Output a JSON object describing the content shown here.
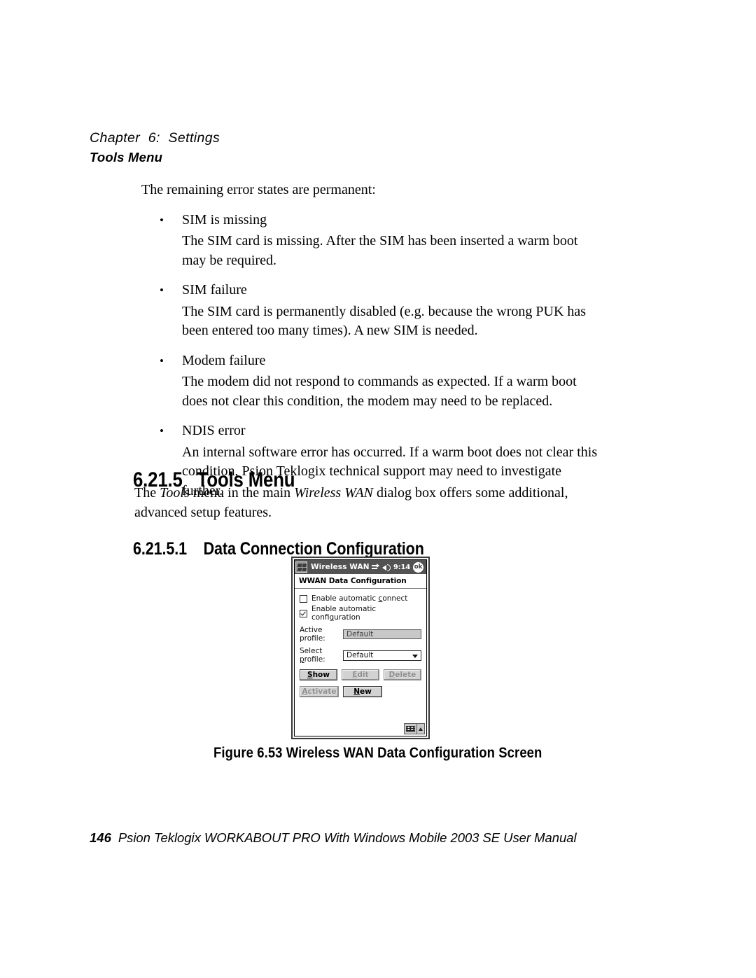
{
  "header": {
    "chapter": "Chapter  6:  Settings",
    "section": "Tools Menu"
  },
  "body": {
    "intro": "The remaining error states are permanent:",
    "bullets": [
      {
        "term": "SIM is missing",
        "desc": "The SIM card is missing. After the SIM has been inserted a warm boot may be required."
      },
      {
        "term": "SIM failure",
        "desc": "The SIM card is permanently disabled (e.g. because the wrong PUK has been entered too many times). A new SIM is needed."
      },
      {
        "term": "Modem failure",
        "desc": "The modem did not respond to commands as expected. If a warm boot does not clear this condition, the modem may need to be replaced."
      },
      {
        "term": "NDIS error",
        "desc": "An internal software error has occurred. If a warm boot does not clear this condition, Psion Teklogix technical support may need to investigate further."
      }
    ],
    "bullet_marker": "•"
  },
  "headings": {
    "h2_number": "6.21.5",
    "h2_title": "Tools Menu",
    "h2_full": "6.21.5   Tools Menu",
    "h3_number": "6.21.5.1",
    "h3_title": "Data Connection Configuration",
    "h3_full": "6.21.5.1    Data Connection Configuration"
  },
  "lead_paragraph": {
    "before_tools": "The ",
    "tools": "Tools",
    "mid": " menu in the main ",
    "wireless_wan": "Wireless WAN",
    "after": " dialog box offers some additional, advanced setup features."
  },
  "pda": {
    "titlebar": {
      "logo_icon": "windows-logo-icon",
      "title": "Wireless WAN",
      "connectivity_icon": "connectivity-icon",
      "speaker_icon": "speaker-icon",
      "clock": "9:14",
      "ok_label": "ok"
    },
    "subtitle": "WWAN Data Configuration",
    "checkboxes": [
      {
        "label_before": "Enable automatic ",
        "mnemonic": "c",
        "label_after": "onnect",
        "checked": false
      },
      {
        "label_before": "Enable automatic confi",
        "mnemonic": "g",
        "label_after": "uration",
        "checked": true
      }
    ],
    "fields": [
      {
        "label": "Active profile:",
        "value": "Default",
        "type": "readonly"
      },
      {
        "label_before": "Select ",
        "mnemonic": "p",
        "label_after": "rofile:",
        "label": "Select profile:",
        "value": "Default",
        "type": "combobox"
      }
    ],
    "buttons_row1": [
      {
        "before": "",
        "mnemonic": "S",
        "after": "how",
        "label": "Show",
        "enabled": true
      },
      {
        "before": "",
        "mnemonic": "E",
        "after": "dit",
        "label": "Edit",
        "enabled": false
      },
      {
        "before": "",
        "mnemonic": "D",
        "after": "elete",
        "label": "Delete",
        "enabled": false
      }
    ],
    "buttons_row2": [
      {
        "before": "",
        "mnemonic": "A",
        "after": "ctivate",
        "label": "Activate",
        "enabled": false
      },
      {
        "before": "",
        "mnemonic": "N",
        "after": "ew",
        "label": "New",
        "enabled": true
      }
    ],
    "sip": {
      "keyboard_icon": "keyboard-icon",
      "arrow_icon": "chevron-up-icon"
    }
  },
  "figure": {
    "caption": "Figure  6.53  Wireless  WAN  Data  Configuration  Screen"
  },
  "footer": {
    "page_number": "146",
    "title": "Psion Teklogix WORKABOUT PRO With Windows Mobile 2003 SE User Manual"
  }
}
